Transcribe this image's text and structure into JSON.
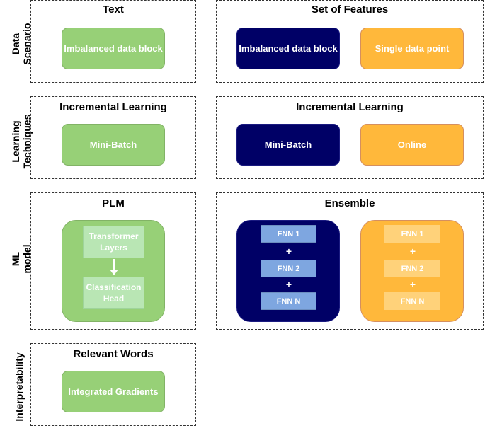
{
  "row_labels": {
    "data_scenario": [
      "Data",
      "Scenario"
    ],
    "learning_techniques": [
      "Learning",
      "Techniques"
    ],
    "ml_model": [
      "ML",
      "model"
    ],
    "interpretability": [
      "Interpretability"
    ]
  },
  "colors": {
    "text_green": "#97d077",
    "features_navy": "#000066",
    "features_orange": "#ffb83b"
  },
  "data_scenario": {
    "text_panel": {
      "title": "Text",
      "box": "Imbalanced data block"
    },
    "features_panel": {
      "title": "Set of Features",
      "box_navy": "Imbalanced data block",
      "box_orange": "Single data point"
    }
  },
  "learning_techniques": {
    "text_panel": {
      "title": "Incremental Learning",
      "box": "Mini-Batch"
    },
    "features_panel": {
      "title": "Incremental Learning",
      "box_navy": "Mini-Batch",
      "box_orange": "Online"
    }
  },
  "ml_model": {
    "text_panel": {
      "title": "PLM",
      "layer_top": "Transformer Layers",
      "layer_bottom": "Classification Head"
    },
    "features_panel": {
      "title": "Ensemble",
      "navy_items": [
        "FNN 1",
        "FNN 2",
        "FNN N"
      ],
      "orange_items": [
        "FNN 1",
        "FNN 2",
        "FNN N"
      ],
      "plus": "+"
    }
  },
  "interpretability": {
    "text_panel": {
      "title": "Relevant Words",
      "box": "Integrated Gradients"
    }
  }
}
